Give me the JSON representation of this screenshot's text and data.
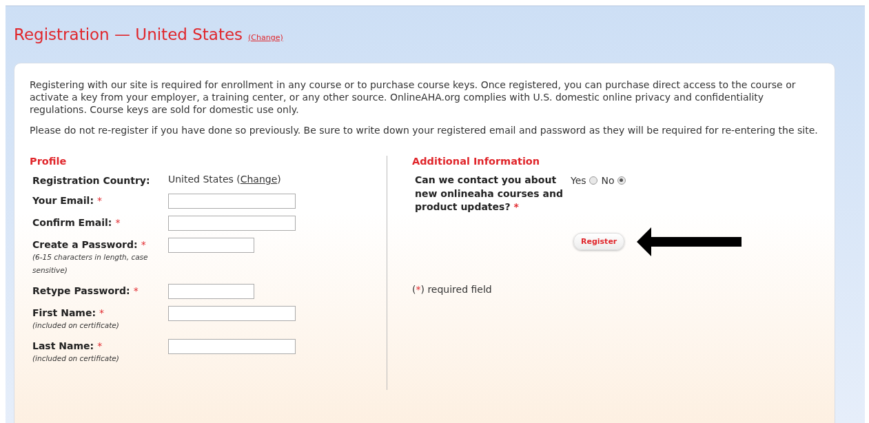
{
  "title": {
    "text": "Registration — United States",
    "link": "(Change)"
  },
  "intro": [
    "Registering with our site is required for enrollment in any course or to purchase course keys. Once registered, you can purchase direct access to the course or activate a key from your employer, a training center, or any other source. OnlineAHA.org complies with U.S. domestic online privacy and confidentiality regulations. Course keys are sold for domestic use only.",
    "Please do not re-register if you have done so previously. Be sure to write down your registered email and password as they will be required for re-entering the site."
  ],
  "profile": {
    "heading": "Profile",
    "country": {
      "label": "Registration Country:",
      "value": "United States",
      "open": "(",
      "link": "Change",
      "close": ")"
    },
    "fields": [
      {
        "label": "Your Email:",
        "mark": "*",
        "kind": "text"
      },
      {
        "label": "Confirm Email:",
        "mark": "*",
        "kind": "text"
      },
      {
        "label": "Create a Password:",
        "mark": "*",
        "hint": "(6-15 characters in length, case sensitive)",
        "kind": "password"
      },
      {
        "label": "Retype Password:",
        "mark": "*",
        "kind": "password"
      },
      {
        "label": "First Name:",
        "mark": "*",
        "hint": "(included on certificate)",
        "kind": "text"
      },
      {
        "label": "Last Name:",
        "mark": "*",
        "hint": "(included on certificate)",
        "kind": "text"
      }
    ]
  },
  "additional": {
    "heading": "Additional Information",
    "question": {
      "text": "Can we contact you about new onlineaha courses and product updates?",
      "mark": "*"
    },
    "options": [
      {
        "label": "Yes",
        "selected": false
      },
      {
        "label": "No",
        "selected": true
      }
    ],
    "button": "Register",
    "note": [
      "(",
      "*",
      ") required field"
    ]
  }
}
